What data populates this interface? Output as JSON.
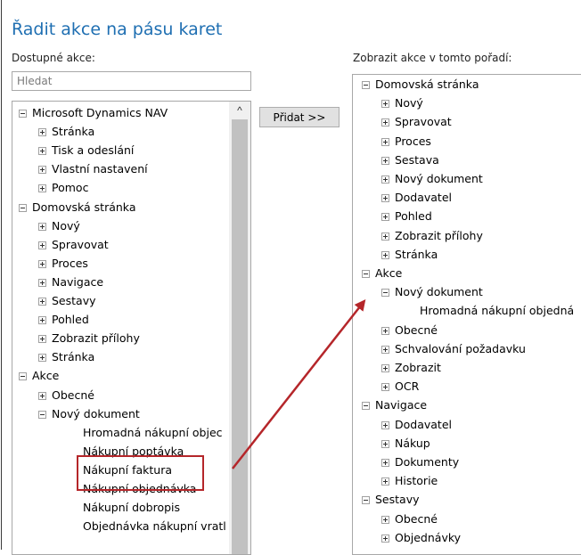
{
  "dialog": {
    "title": "Řadit akce na pásu karet"
  },
  "available": {
    "label": "Dostupné akce:",
    "search_placeholder": "Hledat",
    "rows": [
      {
        "text": "Microsoft Dynamics NAV",
        "level": 0,
        "toggle": "minus"
      },
      {
        "text": "Stránka",
        "level": 1,
        "toggle": "plus"
      },
      {
        "text": "Tisk a odeslání",
        "level": 1,
        "toggle": "plus"
      },
      {
        "text": "Vlastní nastavení",
        "level": 1,
        "toggle": "plus"
      },
      {
        "text": "Pomoc",
        "level": 1,
        "toggle": "plus"
      },
      {
        "text": "Domovská stránka",
        "level": 0,
        "toggle": "minus"
      },
      {
        "text": "Nový",
        "level": 1,
        "toggle": "plus"
      },
      {
        "text": "Spravovat",
        "level": 1,
        "toggle": "plus"
      },
      {
        "text": "Proces",
        "level": 1,
        "toggle": "plus"
      },
      {
        "text": "Navigace",
        "level": 1,
        "toggle": "plus"
      },
      {
        "text": "Sestavy",
        "level": 1,
        "toggle": "plus"
      },
      {
        "text": "Pohled",
        "level": 1,
        "toggle": "plus"
      },
      {
        "text": "Zobrazit přílohy",
        "level": 1,
        "toggle": "plus"
      },
      {
        "text": "Stránka",
        "level": 1,
        "toggle": "plus"
      },
      {
        "text": "Akce",
        "level": 0,
        "toggle": "minus"
      },
      {
        "text": "Obecné",
        "level": 1,
        "toggle": "plus"
      },
      {
        "text": "Nový dokument",
        "level": 1,
        "toggle": "minus"
      },
      {
        "text": "Hromadná nákupní objec",
        "level": 2,
        "toggle": "none"
      },
      {
        "text": "Nákupní poptávka",
        "level": 2,
        "toggle": "none"
      },
      {
        "text": "Nákupní faktura",
        "level": 2,
        "toggle": "none"
      },
      {
        "text": "Nákupní objednávka",
        "level": 2,
        "toggle": "none"
      },
      {
        "text": "Nákupní dobropis",
        "level": 2,
        "toggle": "none"
      },
      {
        "text": "Objednávka nákupní vratl",
        "level": 2,
        "toggle": "none"
      }
    ]
  },
  "add_button": {
    "label": "Přidat >>"
  },
  "ordered": {
    "label": "Zobrazit akce v tomto pořadí:",
    "rows": [
      {
        "text": "Domovská stránka",
        "level": 0,
        "toggle": "minus"
      },
      {
        "text": "Nový",
        "level": 1,
        "toggle": "plus"
      },
      {
        "text": "Spravovat",
        "level": 1,
        "toggle": "plus"
      },
      {
        "text": "Proces",
        "level": 1,
        "toggle": "plus"
      },
      {
        "text": "Sestava",
        "level": 1,
        "toggle": "plus"
      },
      {
        "text": "Nový dokument",
        "level": 1,
        "toggle": "plus"
      },
      {
        "text": "Dodavatel",
        "level": 1,
        "toggle": "plus"
      },
      {
        "text": "Pohled",
        "level": 1,
        "toggle": "plus"
      },
      {
        "text": "Zobrazit přílohy",
        "level": 1,
        "toggle": "plus"
      },
      {
        "text": "Stránka",
        "level": 1,
        "toggle": "plus"
      },
      {
        "text": "Akce",
        "level": 0,
        "toggle": "minus"
      },
      {
        "text": "Nový dokument",
        "level": 1,
        "toggle": "minus"
      },
      {
        "text": "Hromadná nákupní objedná",
        "level": 2,
        "toggle": "none"
      },
      {
        "text": "Obecné",
        "level": 1,
        "toggle": "plus"
      },
      {
        "text": "Schvalování požadavku",
        "level": 1,
        "toggle": "plus"
      },
      {
        "text": "Zobrazit",
        "level": 1,
        "toggle": "plus"
      },
      {
        "text": "OCR",
        "level": 1,
        "toggle": "plus"
      },
      {
        "text": "Navigace",
        "level": 0,
        "toggle": "minus"
      },
      {
        "text": "Dodavatel",
        "level": 1,
        "toggle": "plus"
      },
      {
        "text": "Nákup",
        "level": 1,
        "toggle": "plus"
      },
      {
        "text": "Dokumenty",
        "level": 1,
        "toggle": "plus"
      },
      {
        "text": "Historie",
        "level": 1,
        "toggle": "plus"
      },
      {
        "text": "Sestavy",
        "level": 0,
        "toggle": "minus"
      },
      {
        "text": "Obecné",
        "level": 1,
        "toggle": "plus"
      },
      {
        "text": "Objednávky",
        "level": 1,
        "toggle": "plus"
      }
    ]
  },
  "colors": {
    "title": "#1f6fb2",
    "highlight_box": "#b5262a",
    "arrow": "#b5262a"
  }
}
